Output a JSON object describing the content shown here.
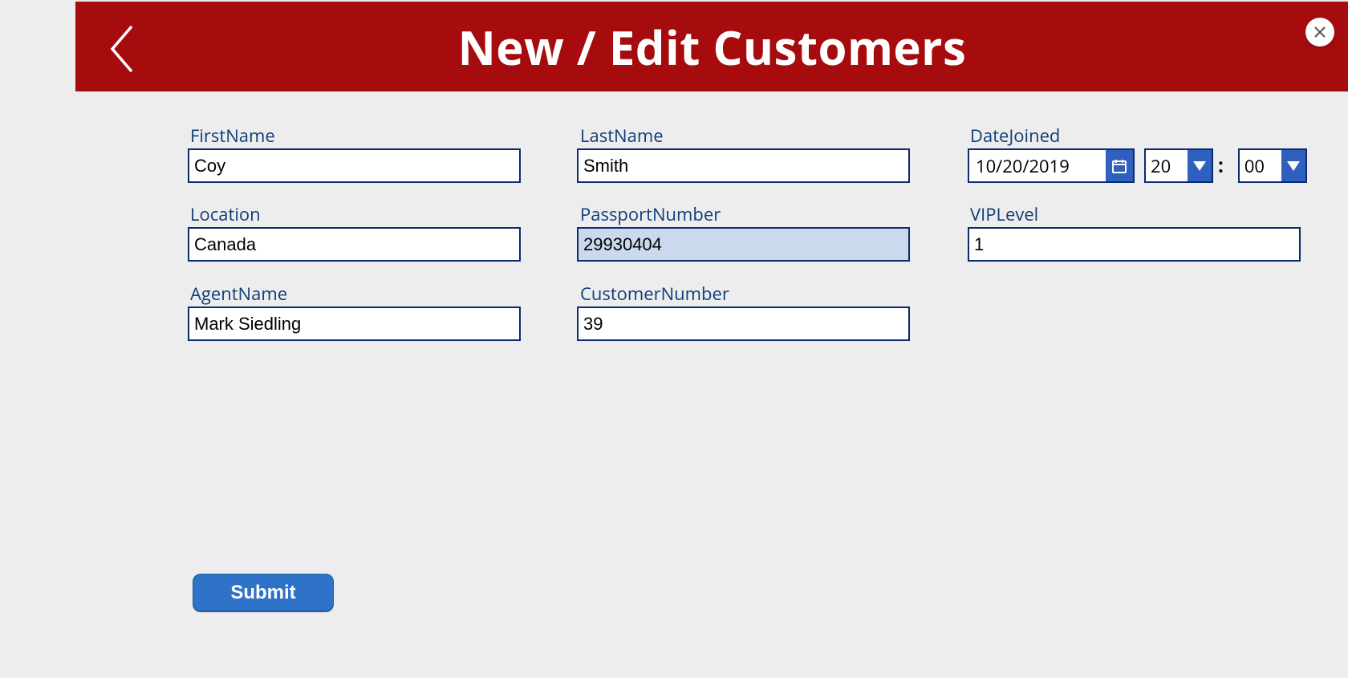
{
  "header": {
    "title": "New / Edit Customers"
  },
  "form": {
    "labels": {
      "firstName": "FirstName",
      "lastName": "LastName",
      "dateJoined": "DateJoined",
      "location": "Location",
      "passportNumber": "PassportNumber",
      "vipLevel": "VIPLevel",
      "agentName": "AgentName",
      "customerNumber": "CustomerNumber"
    },
    "values": {
      "firstName": "Coy",
      "lastName": "Smith",
      "date": "10/20/2019",
      "hour": "20",
      "minute": "00",
      "location": "Canada",
      "passportNumber": "29930404",
      "vipLevel": "1",
      "agentName": "Mark Siedling",
      "customerNumber": "39"
    },
    "timeSeparator": ":",
    "submitLabel": "Submit"
  }
}
